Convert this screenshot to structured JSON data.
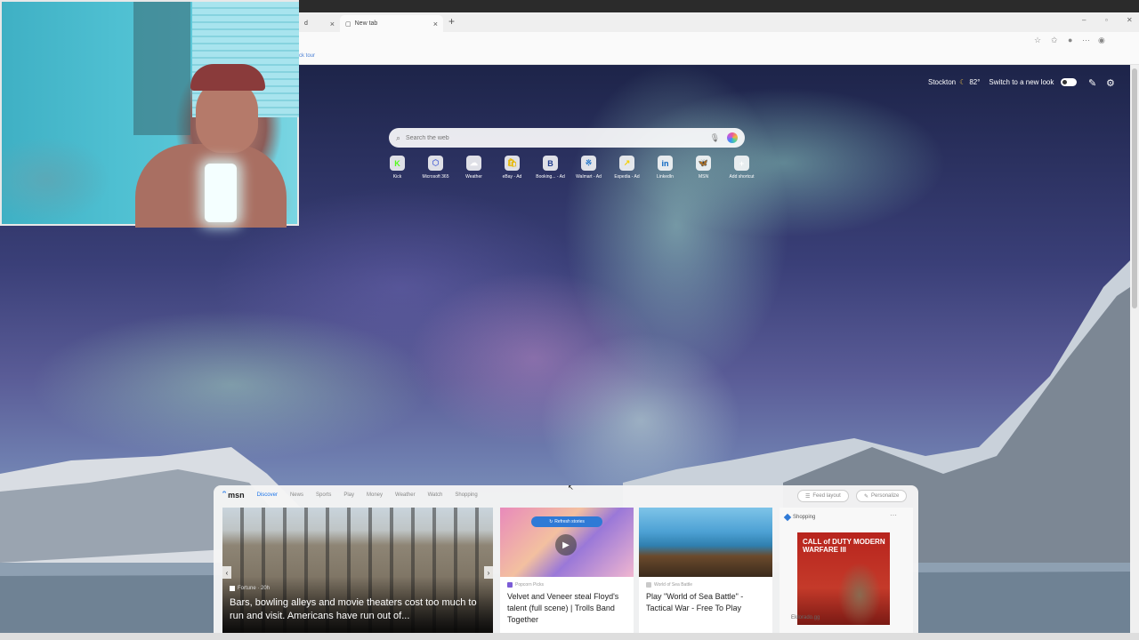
{
  "browser": {
    "tabs": [
      {
        "label": "d",
        "active": false
      },
      {
        "label": "New tab",
        "active": true
      }
    ],
    "favorites_bar_text": "ck tour"
  },
  "header": {
    "location": "Stockton",
    "temperature": "82°",
    "new_look_label": "Switch to a new look",
    "weather_icon": "moon-icon"
  },
  "search": {
    "placeholder": "Search the web"
  },
  "quick_links": [
    {
      "label": "Kick",
      "glyph": "K",
      "color": "#53fc18"
    },
    {
      "label": "Microsoft 365",
      "glyph": "⬡",
      "color": "#5b6fd6"
    },
    {
      "label": "Weather",
      "glyph": "☁",
      "color": "#ffffff"
    },
    {
      "label": "eBay - Ad",
      "glyph": "🛍",
      "color": "#e6b800"
    },
    {
      "label": "Booking... - Ad",
      "glyph": "B",
      "color": "#1f3b8c"
    },
    {
      "label": "Walmart - Ad",
      "glyph": "※",
      "color": "#1f73c9"
    },
    {
      "label": "Expedia - Ad",
      "glyph": "↗",
      "color": "#f5d000"
    },
    {
      "label": "LinkedIn",
      "glyph": "in",
      "color": "#0a66c2"
    },
    {
      "label": "MSN",
      "glyph": "🦋",
      "color": "#d64b8a"
    },
    {
      "label": "Add shortcut",
      "glyph": "+",
      "color": "#ffffff"
    }
  ],
  "feed": {
    "logo_text": "msn",
    "nav_tabs": [
      "Discover",
      "News",
      "Sports",
      "Play",
      "Money",
      "Weather",
      "Watch",
      "Shopping"
    ],
    "feed_layout_label": "Feed layout",
    "personalize_label": "Personalize",
    "cards": [
      {
        "source": "Fortune · 20h",
        "title": "Bars, bowling alleys and movie theaters cost too much to run and visit. Americans have run out of..."
      },
      {
        "source": "Popcorn Picks",
        "title": "Velvet and Veneer steal Floyd's talent (full scene) | Trolls Band Together",
        "refresh_label": "Refresh stories"
      },
      {
        "source": "World of Sea Battle",
        "title": "Play \"World of Sea Battle\" - Tactical War - Free To Play"
      }
    ],
    "shopping": {
      "header": "Shopping",
      "product_text": "CALL of DUTY MODERN WARFARE III",
      "store": "Eldorado.gg"
    }
  },
  "colors": {
    "accent": "#1a73e8"
  }
}
